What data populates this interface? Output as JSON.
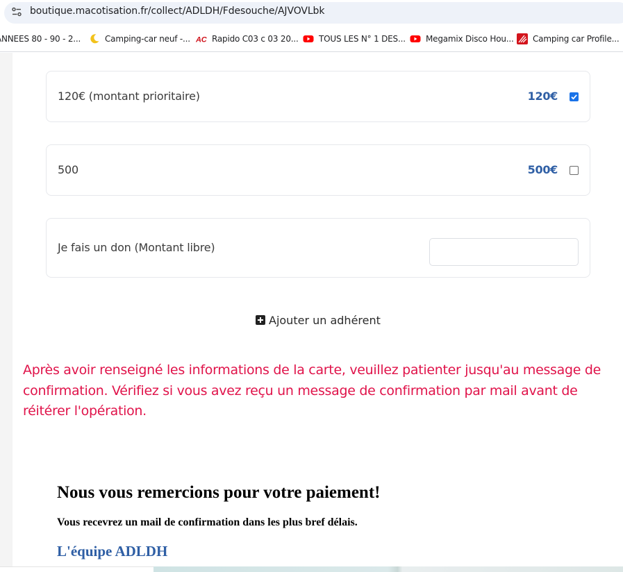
{
  "browser": {
    "url": "boutique.macotisation.fr/collect/ADLDH/Fdesouche/AJVOVLbk",
    "bookmarks": [
      {
        "label": "ANNEES 80 - 90 - 2...",
        "icon": "none"
      },
      {
        "label": "Camping-car neuf -...",
        "icon": "crescent-icon"
      },
      {
        "label": "Rapido C03 c 03 20...",
        "icon": "ac-logo-icon"
      },
      {
        "label": "TOUS LES N° 1 DES...",
        "icon": "youtube-icon"
      },
      {
        "label": "Megamix Disco Hou...",
        "icon": "youtube-icon"
      },
      {
        "label": "Camping car Profile...",
        "icon": "profile-logo-icon"
      }
    ]
  },
  "options": [
    {
      "label": "120€ (montant prioritaire)",
      "price": "120€",
      "checked": true
    },
    {
      "label": "500",
      "price": "500€",
      "checked": false
    }
  ],
  "donation": {
    "label": "Je fais un don (Montant libre)",
    "value": ""
  },
  "add_member": {
    "label": "Ajouter un adhérent"
  },
  "warning": "Après avoir renseigné les informations de la carte, veuillez patienter jusqu'au message de confirmation. Vérifiez si vous avez reçu un message de confirmation par mail avant de réitérer l'opération.",
  "thanks": {
    "title": "Nous vous remercions pour votre paiement!",
    "subtitle": "Vous recevrez un mail de confirmation dans les plus bref délais.",
    "signature": "L'équipe ADLDH"
  },
  "colors": {
    "price": "#2f5fa5",
    "warning": "#e0134a",
    "checkbox": "#1a73e8",
    "youtube": "#ff0000"
  }
}
